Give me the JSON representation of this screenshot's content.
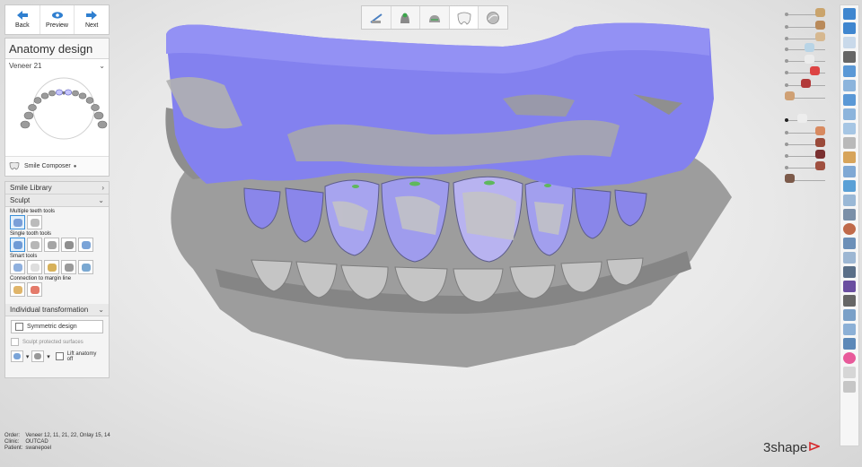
{
  "nav": {
    "back": "Back",
    "preview": "Preview",
    "next": "Next"
  },
  "anatomy": {
    "title": "Anatomy design",
    "restoration": "Veneer 21",
    "smile_composer": "Smile Composer"
  },
  "sculpt": {
    "smile_library": "Smile Library",
    "sculpt": "Sculpt",
    "multiple_teeth_tools": "Multiple teeth tools",
    "single_tooth_tools": "Single tooth tools",
    "smart_tools": "Smart tools",
    "connection_to_margin_line": "Connection to margin line",
    "individual_transformation": "Individual transformation",
    "symmetric_design": "Symmetric design",
    "sculpt_protected_surfaces": "Sculpt protected surfaces",
    "lift_anatomy_off": "Lift anatomy off"
  },
  "info": {
    "order_label": "Order:",
    "order_value": "Veneer 12, 11, 21, 22, Onlay 15, 14",
    "clinic_label": "Clinic:",
    "clinic_value": "OUTCAD",
    "patient_label": "Patient:",
    "patient_value": "swanepoel"
  },
  "brand": "3shape",
  "colors": {
    "accent": "#2f7fd0",
    "model_gray": "#9d9d9d",
    "wax_blue": "#8483f0",
    "brand_red": "#d6282b"
  },
  "top_tools": [
    "scan-tool-icon",
    "preparation-tool-icon",
    "model-tool-icon",
    "tooth-design-icon",
    "sphere-view-icon"
  ]
}
